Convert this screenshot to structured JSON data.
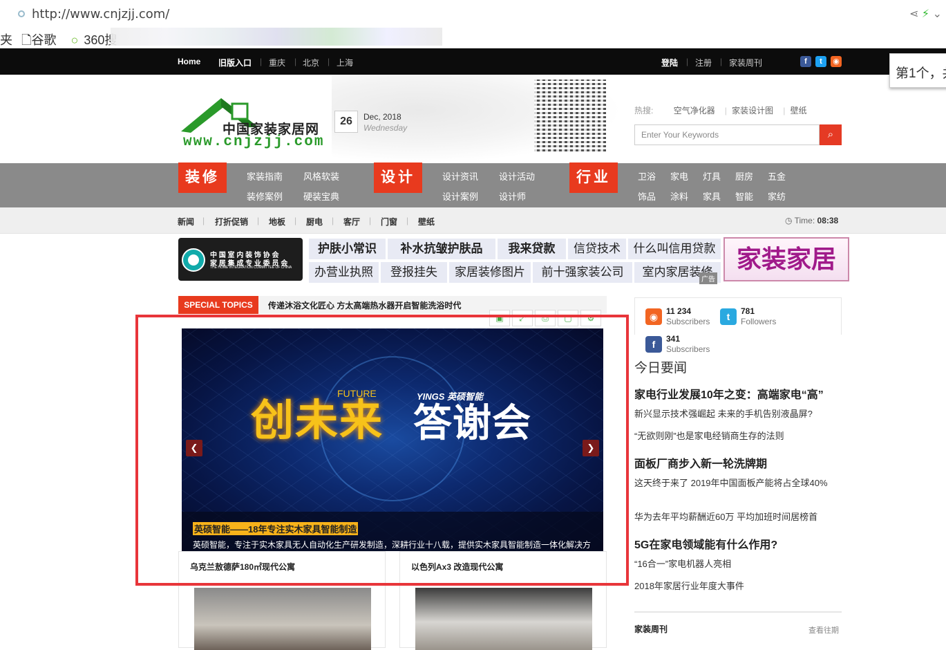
{
  "browser": {
    "url": "http://www.cnjzjj.com/",
    "bookmarks": [
      "夹",
      "谷歌",
      "360搜"
    ]
  },
  "topbar": {
    "links": [
      "Home",
      "旧版入口",
      "重庆",
      "北京",
      "上海"
    ],
    "right": [
      "登陆",
      "注册",
      "家装周刊"
    ],
    "popup": "第1个，共"
  },
  "header": {
    "logo_cn": "中国家装家居网",
    "logo_url": "www.cnjzjj.com",
    "date_day": "26",
    "date_monthyear": "Dec, 2018",
    "date_weekday": "Wednesday",
    "hot_label": "热搜:",
    "hot_terms": [
      "空气净化器",
      "家装设计图",
      "壁纸"
    ],
    "search_placeholder": "Enter Your Keywords"
  },
  "mainnav": {
    "groups": [
      {
        "tag": "装修",
        "links": [
          "家装指南",
          "风格软装",
          "装修案例",
          "硬装宝典"
        ]
      },
      {
        "tag": "设计",
        "links": [
          "设计资讯",
          "设计活动",
          "设计案例",
          "设计师"
        ]
      },
      {
        "tag": "行业",
        "links": [
          "卫浴",
          "家电",
          "灯具",
          "厨房",
          "五金",
          "饰品",
          "涂料",
          "家具",
          "智能",
          "家纺"
        ]
      }
    ]
  },
  "subnav": {
    "links": [
      "新闻",
      "打折促销",
      "地板",
      "厨电",
      "客厅",
      "门窗",
      "壁纸"
    ],
    "time_label": "Time:",
    "time_value": "08:38"
  },
  "ads": {
    "assoc_line1": "中 国 室 内 装 饰 协 会",
    "assoc_line2": "家 居 集 成 专 业 委 员 会",
    "assoc_line3": "THE HOME INTEGRATION COMMITTEE OF CHINA",
    "row1": [
      "护肤小常识",
      "补水抗皱护肤品",
      "我来贷款",
      "信贷技术",
      "什么叫信用贷款"
    ],
    "row2": [
      "办营业执照",
      "登报挂失",
      "家居装修图片",
      "前十强家装公司",
      "室内家居装修"
    ],
    "ad_tag": "广告",
    "banner": "家装家居"
  },
  "special": {
    "label": "SPECIAL TOPICS",
    "headline": "传递沐浴文化匠心 方太高端热水器开启智能洗浴时代"
  },
  "slider": {
    "future": "FUTURE",
    "brand": "YINGS 英硕智能",
    "main_left": "创未来",
    "main_right": "答谢会",
    "caption_title": "英硕智能——18年专注实木家具智能制造",
    "caption_desc": "英硕智能，专注于实木家具无人自动化生产研发制造，深耕行业十八载，提供实木家具智能制造一体化解决方"
  },
  "cards": [
    {
      "title": "乌克兰敖德萨180㎡现代公寓"
    },
    {
      "title": "以色列Ax3 改造现代公寓"
    }
  ],
  "social": {
    "rss_count": "11 234",
    "rss_label": "Subscribers",
    "tw_count": "781",
    "tw_label": "Followers",
    "fb_count": "341",
    "fb_label": "Subscribers"
  },
  "news": {
    "title": "今日要闻",
    "items": [
      {
        "type": "h",
        "text": "家电行业发展10年之变：高端家电“高”"
      },
      {
        "type": "i",
        "text": "新兴显示技术强崛起 未来的手机告别液晶屏?"
      },
      {
        "type": "i",
        "text": "“无欲则刚”也是家电经销商生存的法则"
      },
      {
        "type": "h",
        "text": "面板厂商步入新一轮洗牌期"
      },
      {
        "type": "i",
        "text": "这天终于来了 2019年中国面板产能将占全球40%"
      },
      {
        "type": "i",
        "text": "华为去年平均薪酬近60万 平均加班时间居榜首"
      },
      {
        "type": "h",
        "text": "5G在家电领域能有什么作用?"
      },
      {
        "type": "i",
        "text": "“16合一”家电机器人亮相"
      },
      {
        "type": "i",
        "text": "2018年家居行业年度大事件"
      }
    ]
  },
  "weekly": {
    "title": "家装周刊",
    "more": "查看往期"
  }
}
